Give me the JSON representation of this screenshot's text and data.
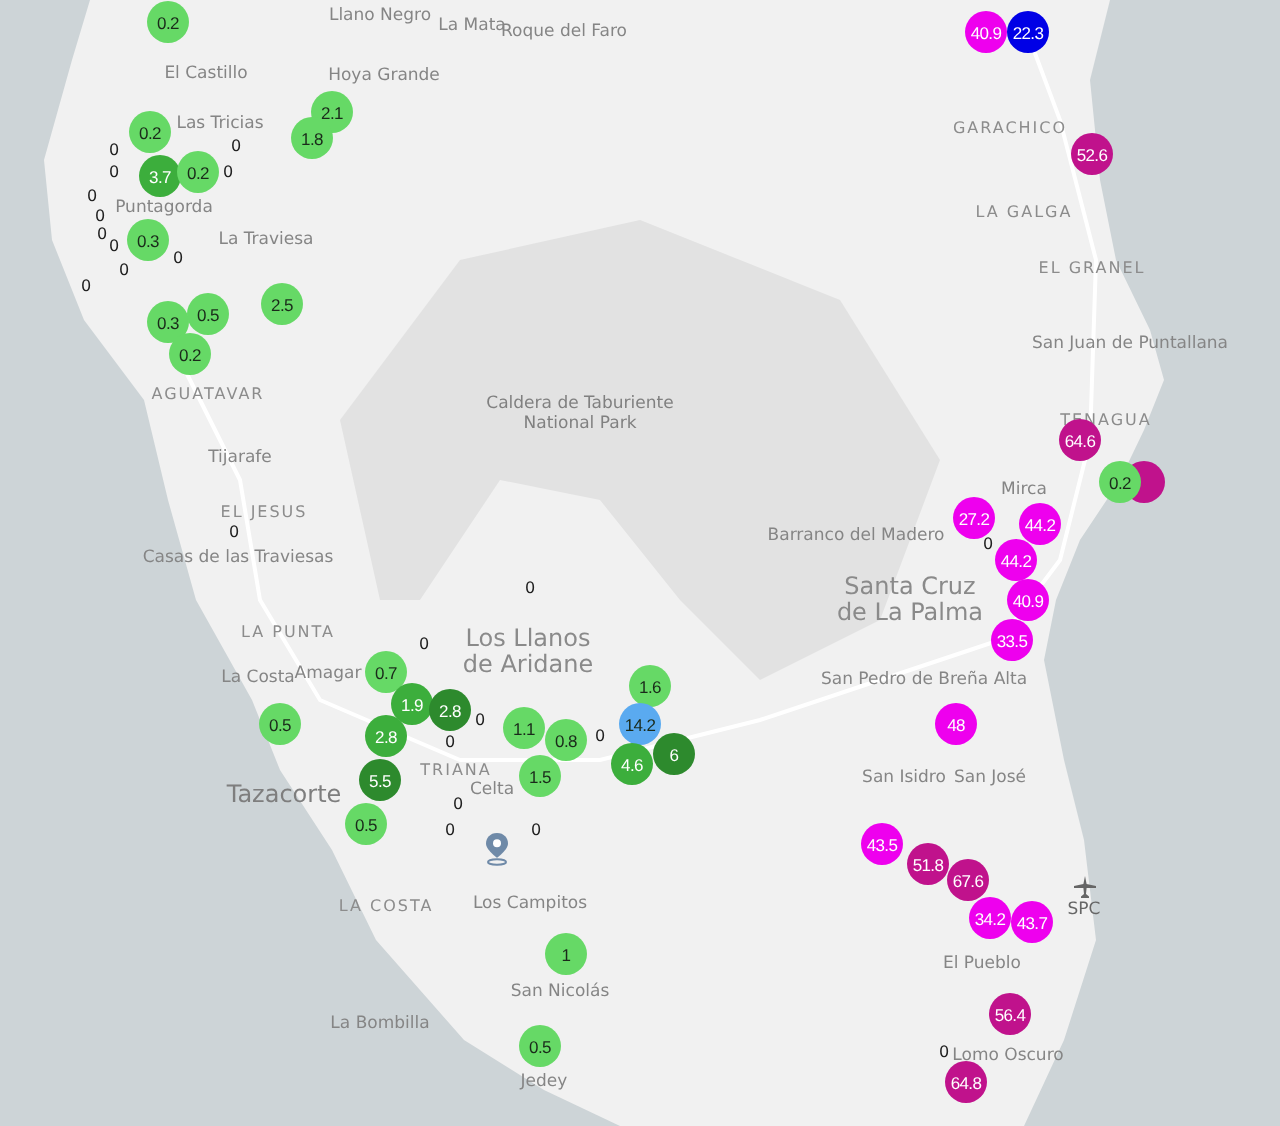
{
  "map": {
    "places": [
      {
        "name": "Llano Negro",
        "kind": "town"
      },
      {
        "name": "La Mata",
        "kind": "town"
      },
      {
        "name": "Roque del Faro",
        "kind": "town"
      },
      {
        "name": "El Castillo",
        "kind": "town"
      },
      {
        "name": "Hoya Grande",
        "kind": "town"
      },
      {
        "name": "Las Tricias",
        "kind": "town"
      },
      {
        "name": "Puntagorda",
        "kind": "town"
      },
      {
        "name": "La Traviesa",
        "kind": "town"
      },
      {
        "name": "AGUATAVAR",
        "kind": "area"
      },
      {
        "name": "Caldera de Taburiente National Park",
        "kind": "park"
      },
      {
        "name": "Tijarafe",
        "kind": "town"
      },
      {
        "name": "EL JESUS",
        "kind": "area"
      },
      {
        "name": "Casas de las Traviesas",
        "kind": "town"
      },
      {
        "name": "LA PUNTA",
        "kind": "area"
      },
      {
        "name": "La Costa",
        "kind": "town"
      },
      {
        "name": "Amagar",
        "kind": "town"
      },
      {
        "name": "Los Llanos de Aridane",
        "kind": "city"
      },
      {
        "name": "TRIANA",
        "kind": "area"
      },
      {
        "name": "Tazacorte",
        "kind": "bigtown"
      },
      {
        "name": "Celta",
        "kind": "town"
      },
      {
        "name": "LA COSTA",
        "kind": "area"
      },
      {
        "name": "Los Campitos",
        "kind": "town"
      },
      {
        "name": "San Nicolás",
        "kind": "town"
      },
      {
        "name": "La Bombilla",
        "kind": "town"
      },
      {
        "name": "Jedey",
        "kind": "town"
      },
      {
        "name": "GARACHICO",
        "kind": "area"
      },
      {
        "name": "LA GALGA",
        "kind": "area"
      },
      {
        "name": "EL GRANEL",
        "kind": "area"
      },
      {
        "name": "San Juan de Puntallana",
        "kind": "town"
      },
      {
        "name": "TENAGUA",
        "kind": "area"
      },
      {
        "name": "Mirca",
        "kind": "town"
      },
      {
        "name": "Barranco del Madero",
        "kind": "town"
      },
      {
        "name": "Santa Cruz de La Palma",
        "kind": "city"
      },
      {
        "name": "San Pedro de Breña Alta",
        "kind": "town"
      },
      {
        "name": "San Isidro",
        "kind": "town"
      },
      {
        "name": "San José",
        "kind": "town"
      },
      {
        "name": "El Pueblo",
        "kind": "town"
      },
      {
        "name": "Lomo Oscuro",
        "kind": "town"
      }
    ],
    "markers": [
      {
        "value": "0.2",
        "color": "#66d966"
      },
      {
        "value": "2.1",
        "color": "#66d966"
      },
      {
        "value": "1.8",
        "color": "#66d966"
      },
      {
        "value": "0.2",
        "color": "#66d966"
      },
      {
        "value": "3.7",
        "color": "#3cae3c"
      },
      {
        "value": "0.2",
        "color": "#66d966"
      },
      {
        "value": "0.3",
        "color": "#66d966"
      },
      {
        "value": "2.5",
        "color": "#66d966"
      },
      {
        "value": "0.3",
        "color": "#66d966"
      },
      {
        "value": "0.5",
        "color": "#66d966"
      },
      {
        "value": "0.2",
        "color": "#66d966"
      },
      {
        "value": "0.5",
        "color": "#66d966"
      },
      {
        "value": "0.7",
        "color": "#66d966"
      },
      {
        "value": "1.9",
        "color": "#3cae3c"
      },
      {
        "value": "2.8",
        "color": "#2d8a2d"
      },
      {
        "value": "2.8",
        "color": "#3cae3c"
      },
      {
        "value": "5.5",
        "color": "#2d8a2d"
      },
      {
        "value": "0.5",
        "color": "#66d966"
      },
      {
        "value": "1.1",
        "color": "#66d966"
      },
      {
        "value": "0.8",
        "color": "#66d966"
      },
      {
        "value": "1.5",
        "color": "#66d966"
      },
      {
        "value": "1.6",
        "color": "#66d966"
      },
      {
        "value": "14.2",
        "color": "#5aaaf0"
      },
      {
        "value": "4.6",
        "color": "#3cae3c"
      },
      {
        "value": "6",
        "color": "#2d8a2d"
      },
      {
        "value": "1",
        "color": "#66d966"
      },
      {
        "value": "0.5",
        "color": "#66d966"
      },
      {
        "color": "#c0128c"
      },
      {
        "value": "0.2",
        "color": "#66d966"
      },
      {
        "value": "40.9",
        "color": "#ee00ee"
      },
      {
        "value": "22.3",
        "color": "#0000e6"
      },
      {
        "value": "52.6",
        "color": "#c0128c"
      },
      {
        "value": "64.6",
        "color": "#c0128c"
      },
      {
        "value": "27.2",
        "color": "#ee00ee"
      },
      {
        "value": "44.2",
        "color": "#ee00ee"
      },
      {
        "value": "44.2",
        "color": "#ee00ee"
      },
      {
        "value": "40.9",
        "color": "#ee00ee"
      },
      {
        "value": "33.5",
        "color": "#ee00ee"
      },
      {
        "value": "48",
        "color": "#ee00ee"
      },
      {
        "value": "43.5",
        "color": "#ee00ee"
      },
      {
        "value": "51.8",
        "color": "#c0128c"
      },
      {
        "value": "67.6",
        "color": "#c0128c"
      },
      {
        "value": "34.2",
        "color": "#ee00ee"
      },
      {
        "value": "43.7",
        "color": "#ee00ee"
      },
      {
        "value": "56.4",
        "color": "#c0128c"
      },
      {
        "value": "64.8",
        "color": "#c0128c"
      }
    ],
    "zero_labels": [
      "0",
      "0",
      "0",
      "0",
      "0",
      "0",
      "0",
      "0",
      "0",
      "0",
      "0",
      "0",
      "0",
      "0",
      "0",
      "0",
      "0",
      "0",
      "0",
      "0",
      "0",
      "0"
    ],
    "airport": {
      "code": "SPC"
    }
  }
}
